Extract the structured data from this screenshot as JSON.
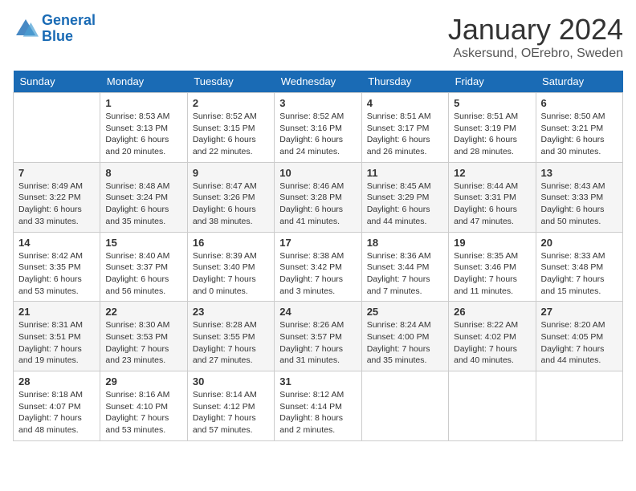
{
  "header": {
    "logo_line1": "General",
    "logo_line2": "Blue",
    "month_title": "January 2024",
    "location": "Askersund, OErebro, Sweden"
  },
  "weekdays": [
    "Sunday",
    "Monday",
    "Tuesday",
    "Wednesday",
    "Thursday",
    "Friday",
    "Saturday"
  ],
  "weeks": [
    [
      {
        "day": "",
        "info": ""
      },
      {
        "day": "1",
        "info": "Sunrise: 8:53 AM\nSunset: 3:13 PM\nDaylight: 6 hours\nand 20 minutes."
      },
      {
        "day": "2",
        "info": "Sunrise: 8:52 AM\nSunset: 3:15 PM\nDaylight: 6 hours\nand 22 minutes."
      },
      {
        "day": "3",
        "info": "Sunrise: 8:52 AM\nSunset: 3:16 PM\nDaylight: 6 hours\nand 24 minutes."
      },
      {
        "day": "4",
        "info": "Sunrise: 8:51 AM\nSunset: 3:17 PM\nDaylight: 6 hours\nand 26 minutes."
      },
      {
        "day": "5",
        "info": "Sunrise: 8:51 AM\nSunset: 3:19 PM\nDaylight: 6 hours\nand 28 minutes."
      },
      {
        "day": "6",
        "info": "Sunrise: 8:50 AM\nSunset: 3:21 PM\nDaylight: 6 hours\nand 30 minutes."
      }
    ],
    [
      {
        "day": "7",
        "info": "Sunrise: 8:49 AM\nSunset: 3:22 PM\nDaylight: 6 hours\nand 33 minutes."
      },
      {
        "day": "8",
        "info": "Sunrise: 8:48 AM\nSunset: 3:24 PM\nDaylight: 6 hours\nand 35 minutes."
      },
      {
        "day": "9",
        "info": "Sunrise: 8:47 AM\nSunset: 3:26 PM\nDaylight: 6 hours\nand 38 minutes."
      },
      {
        "day": "10",
        "info": "Sunrise: 8:46 AM\nSunset: 3:28 PM\nDaylight: 6 hours\nand 41 minutes."
      },
      {
        "day": "11",
        "info": "Sunrise: 8:45 AM\nSunset: 3:29 PM\nDaylight: 6 hours\nand 44 minutes."
      },
      {
        "day": "12",
        "info": "Sunrise: 8:44 AM\nSunset: 3:31 PM\nDaylight: 6 hours\nand 47 minutes."
      },
      {
        "day": "13",
        "info": "Sunrise: 8:43 AM\nSunset: 3:33 PM\nDaylight: 6 hours\nand 50 minutes."
      }
    ],
    [
      {
        "day": "14",
        "info": "Sunrise: 8:42 AM\nSunset: 3:35 PM\nDaylight: 6 hours\nand 53 minutes."
      },
      {
        "day": "15",
        "info": "Sunrise: 8:40 AM\nSunset: 3:37 PM\nDaylight: 6 hours\nand 56 minutes."
      },
      {
        "day": "16",
        "info": "Sunrise: 8:39 AM\nSunset: 3:40 PM\nDaylight: 7 hours\nand 0 minutes."
      },
      {
        "day": "17",
        "info": "Sunrise: 8:38 AM\nSunset: 3:42 PM\nDaylight: 7 hours\nand 3 minutes."
      },
      {
        "day": "18",
        "info": "Sunrise: 8:36 AM\nSunset: 3:44 PM\nDaylight: 7 hours\nand 7 minutes."
      },
      {
        "day": "19",
        "info": "Sunrise: 8:35 AM\nSunset: 3:46 PM\nDaylight: 7 hours\nand 11 minutes."
      },
      {
        "day": "20",
        "info": "Sunrise: 8:33 AM\nSunset: 3:48 PM\nDaylight: 7 hours\nand 15 minutes."
      }
    ],
    [
      {
        "day": "21",
        "info": "Sunrise: 8:31 AM\nSunset: 3:51 PM\nDaylight: 7 hours\nand 19 minutes."
      },
      {
        "day": "22",
        "info": "Sunrise: 8:30 AM\nSunset: 3:53 PM\nDaylight: 7 hours\nand 23 minutes."
      },
      {
        "day": "23",
        "info": "Sunrise: 8:28 AM\nSunset: 3:55 PM\nDaylight: 7 hours\nand 27 minutes."
      },
      {
        "day": "24",
        "info": "Sunrise: 8:26 AM\nSunset: 3:57 PM\nDaylight: 7 hours\nand 31 minutes."
      },
      {
        "day": "25",
        "info": "Sunrise: 8:24 AM\nSunset: 4:00 PM\nDaylight: 7 hours\nand 35 minutes."
      },
      {
        "day": "26",
        "info": "Sunrise: 8:22 AM\nSunset: 4:02 PM\nDaylight: 7 hours\nand 40 minutes."
      },
      {
        "day": "27",
        "info": "Sunrise: 8:20 AM\nSunset: 4:05 PM\nDaylight: 7 hours\nand 44 minutes."
      }
    ],
    [
      {
        "day": "28",
        "info": "Sunrise: 8:18 AM\nSunset: 4:07 PM\nDaylight: 7 hours\nand 48 minutes."
      },
      {
        "day": "29",
        "info": "Sunrise: 8:16 AM\nSunset: 4:10 PM\nDaylight: 7 hours\nand 53 minutes."
      },
      {
        "day": "30",
        "info": "Sunrise: 8:14 AM\nSunset: 4:12 PM\nDaylight: 7 hours\nand 57 minutes."
      },
      {
        "day": "31",
        "info": "Sunrise: 8:12 AM\nSunset: 4:14 PM\nDaylight: 8 hours\nand 2 minutes."
      },
      {
        "day": "",
        "info": ""
      },
      {
        "day": "",
        "info": ""
      },
      {
        "day": "",
        "info": ""
      }
    ]
  ]
}
